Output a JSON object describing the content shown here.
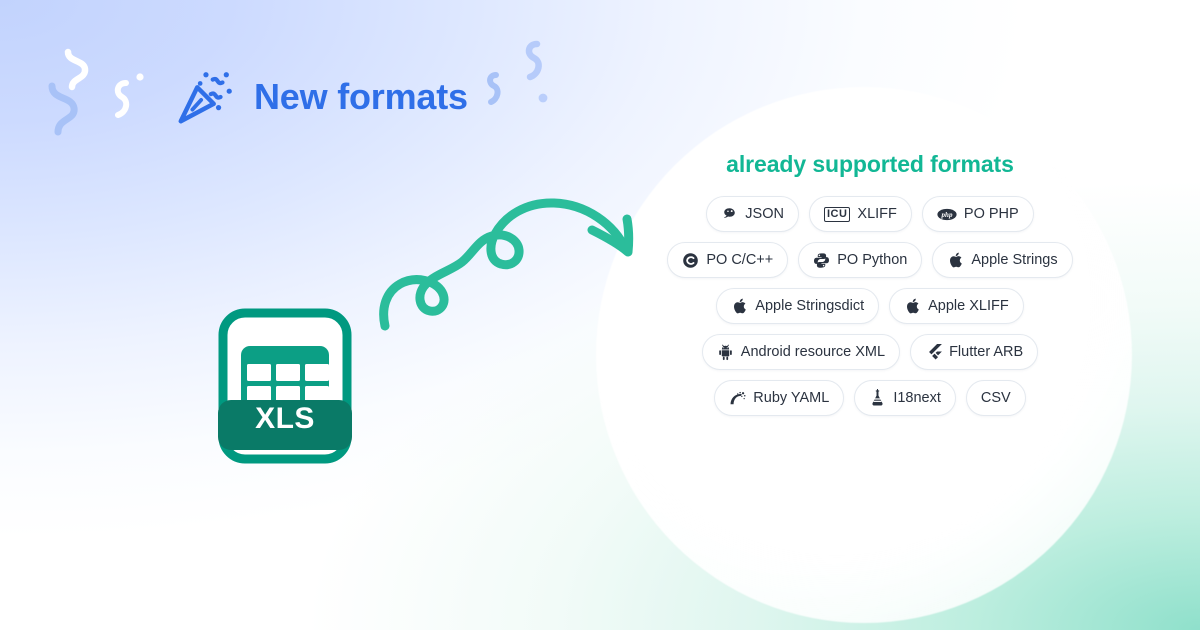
{
  "banner": {
    "background_colors": {
      "top_left": "#c3d4fd",
      "top_right": "#ddf7f1",
      "bottom_right": "#9ce3cf",
      "bottom_left": "#fafafa"
    }
  },
  "header": {
    "icon": "party-popper-icon",
    "title": "New formats",
    "title_color": "#2f6fe8"
  },
  "file_icon": {
    "name": "xls-file-icon",
    "label": "XLS",
    "color": "#009980",
    "badge_color": "#0a7a67"
  },
  "arrow": {
    "name": "curly-arrow-icon",
    "color": "#2bbd9b"
  },
  "formats": {
    "title": "already supported formats",
    "title_color": "#12b795",
    "rows": [
      [
        {
          "label": "JSON",
          "icon": "json-icon"
        },
        {
          "label": "XLIFF",
          "icon": "icu-icon",
          "icon_text": "ICU"
        },
        {
          "label": "PO PHP",
          "icon": "php-icon"
        }
      ],
      [
        {
          "label": "PO C/C++",
          "icon": "c-language-icon"
        },
        {
          "label": "PO Python",
          "icon": "python-icon"
        },
        {
          "label": "Apple Strings",
          "icon": "apple-icon"
        }
      ],
      [
        {
          "label": "Apple Stringsdict",
          "icon": "apple-icon"
        },
        {
          "label": "Apple XLIFF",
          "icon": "apple-icon"
        }
      ],
      [
        {
          "label": "Android resource XML",
          "icon": "android-icon"
        },
        {
          "label": "Flutter ARB",
          "icon": "flutter-icon"
        }
      ],
      [
        {
          "label": "Ruby YAML",
          "icon": "ruby-on-rails-icon"
        },
        {
          "label": "I18next",
          "icon": "i18next-flask-icon"
        },
        {
          "label": "CSV",
          "icon": "none"
        }
      ]
    ]
  }
}
